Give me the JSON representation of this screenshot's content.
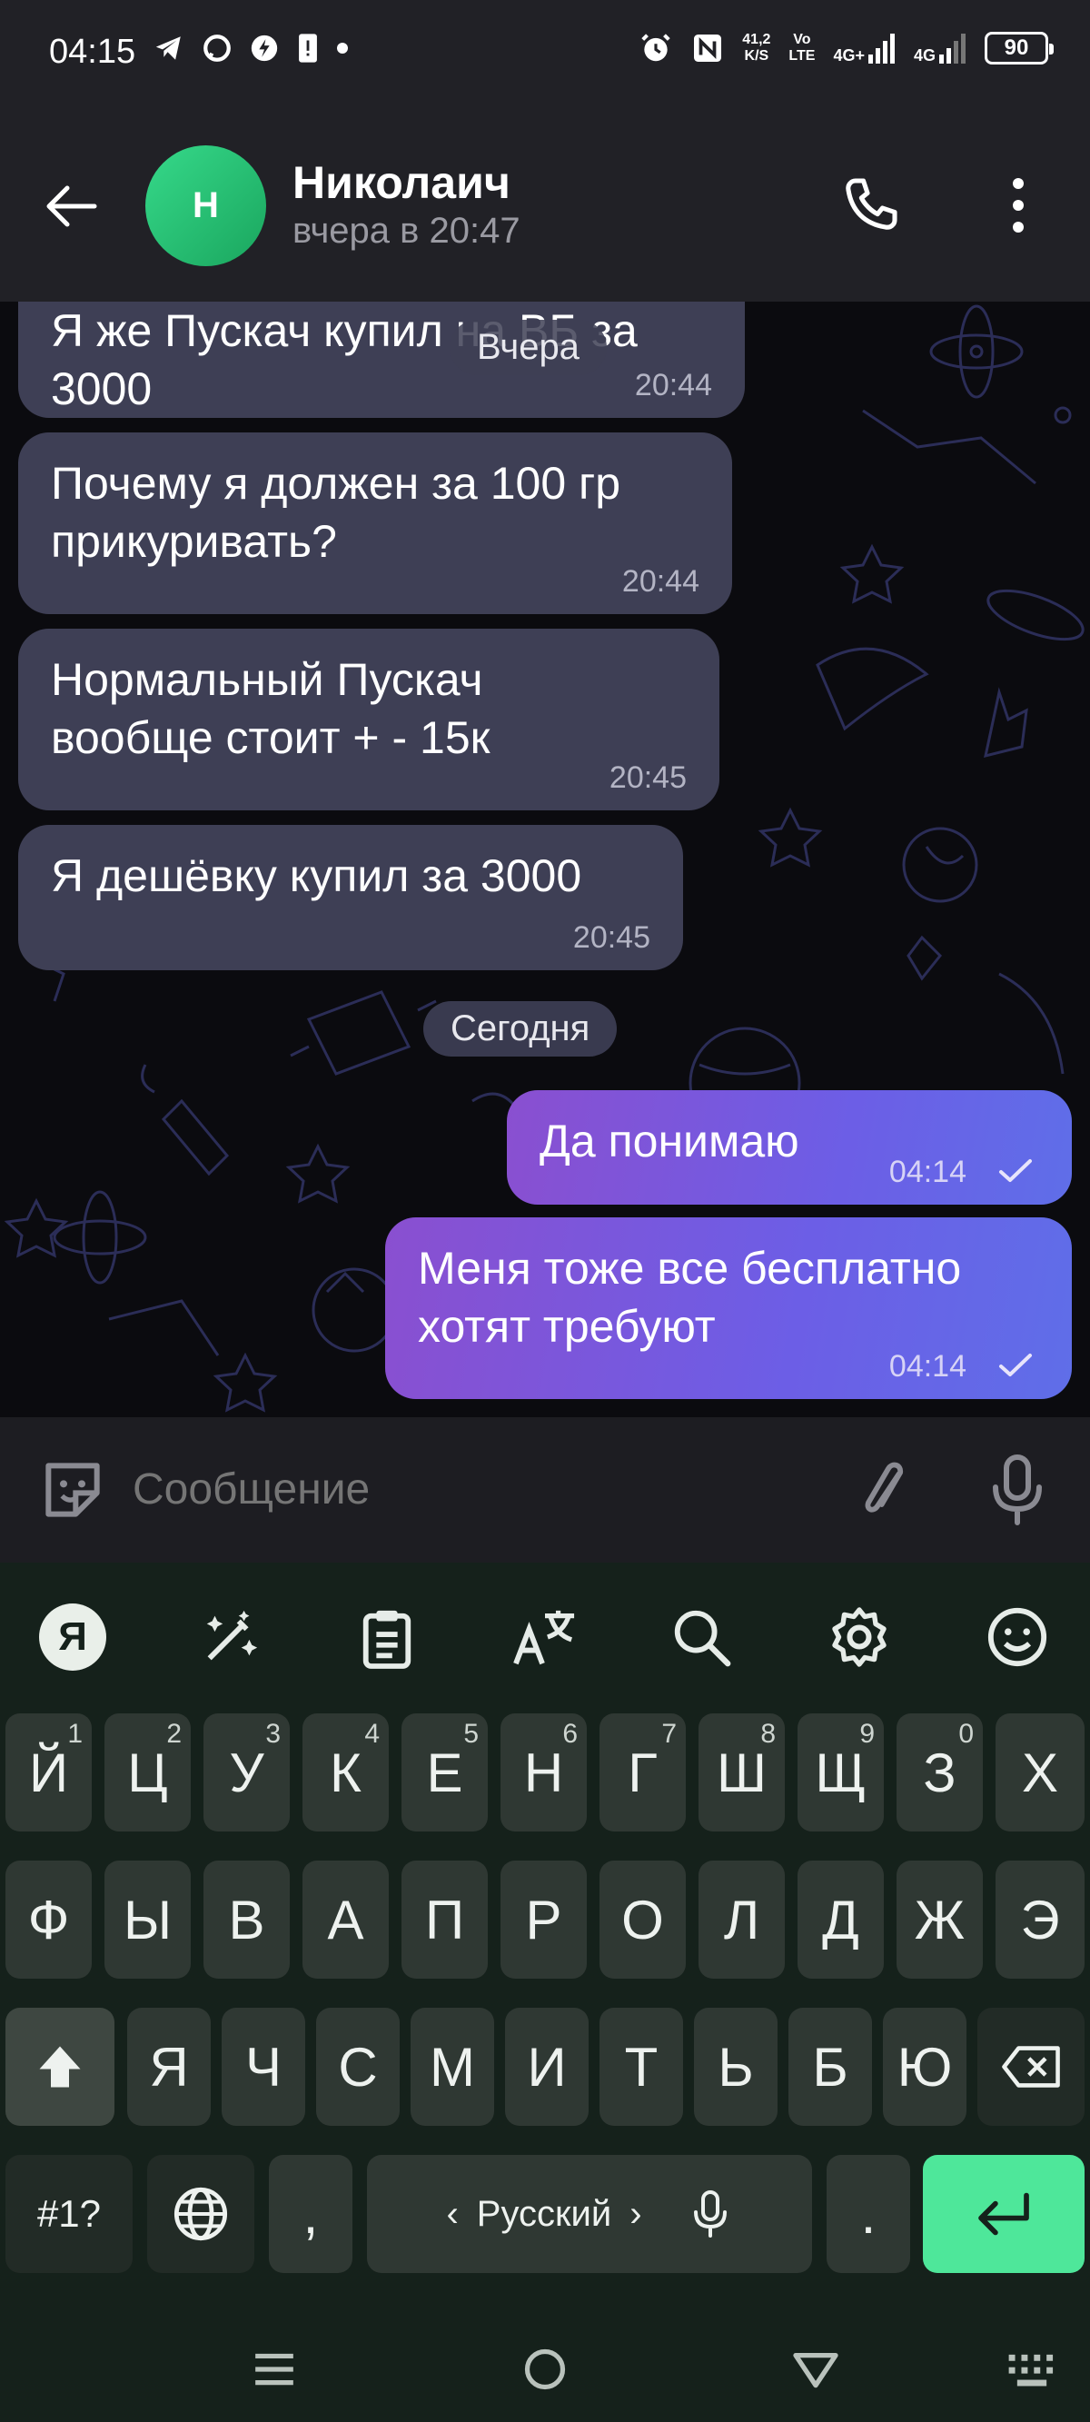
{
  "status_bar": {
    "time": "04:15",
    "speed_value": "41,2",
    "speed_unit": "K/S",
    "volte_top": "Vo",
    "volte_bottom": "LTE",
    "network1": "4G+",
    "network2": "4G",
    "battery": "90"
  },
  "header": {
    "avatar_letter": "Н",
    "contact_name": "Николаич",
    "last_seen": "вчера в 20:47"
  },
  "messages": [
    {
      "direction": "in",
      "text": "Я же Пускач купил на ВБ за\n3000",
      "time": "20:44"
    },
    {
      "direction": "in",
      "text": "Почему я должен за 100 гр\nприкуривать?",
      "time": "20:44"
    },
    {
      "direction": "in",
      "text": "Нормальный Пускач\nвообще стоит + - 15к",
      "time": "20:45"
    },
    {
      "direction": "in",
      "text": "Я дешёвку купил за 3000",
      "time": "20:45"
    },
    {
      "direction": "out",
      "text": "Да понимаю",
      "time": "04:14"
    },
    {
      "direction": "out",
      "text": "Меня тоже все бесплатно\nхотят требуют",
      "time": "04:14"
    }
  ],
  "date_labels": {
    "yesterday": "Вчера",
    "today": "Сегодня"
  },
  "input": {
    "placeholder": "Сообщение"
  },
  "keyboard": {
    "row1": [
      {
        "key": "Й",
        "hint": "1"
      },
      {
        "key": "Ц",
        "hint": "2"
      },
      {
        "key": "У",
        "hint": "3"
      },
      {
        "key": "К",
        "hint": "4"
      },
      {
        "key": "Е",
        "hint": "5"
      },
      {
        "key": "Н",
        "hint": "6"
      },
      {
        "key": "Г",
        "hint": "7"
      },
      {
        "key": "Ш",
        "hint": "8"
      },
      {
        "key": "Щ",
        "hint": "9"
      },
      {
        "key": "З",
        "hint": "0"
      },
      {
        "key": "Х",
        "hint": ""
      }
    ],
    "row2": [
      "Ф",
      "Ы",
      "В",
      "А",
      "П",
      "Р",
      "О",
      "Л",
      "Д",
      "Ж",
      "Э"
    ],
    "row3": [
      "Я",
      "Ч",
      "С",
      "М",
      "И",
      "Т",
      "Ь",
      "Б",
      "Ю"
    ],
    "symbols": "#1?",
    "comma": ",",
    "space_label": "Русский",
    "space_left": "‹",
    "space_right": "›",
    "period": "."
  }
}
